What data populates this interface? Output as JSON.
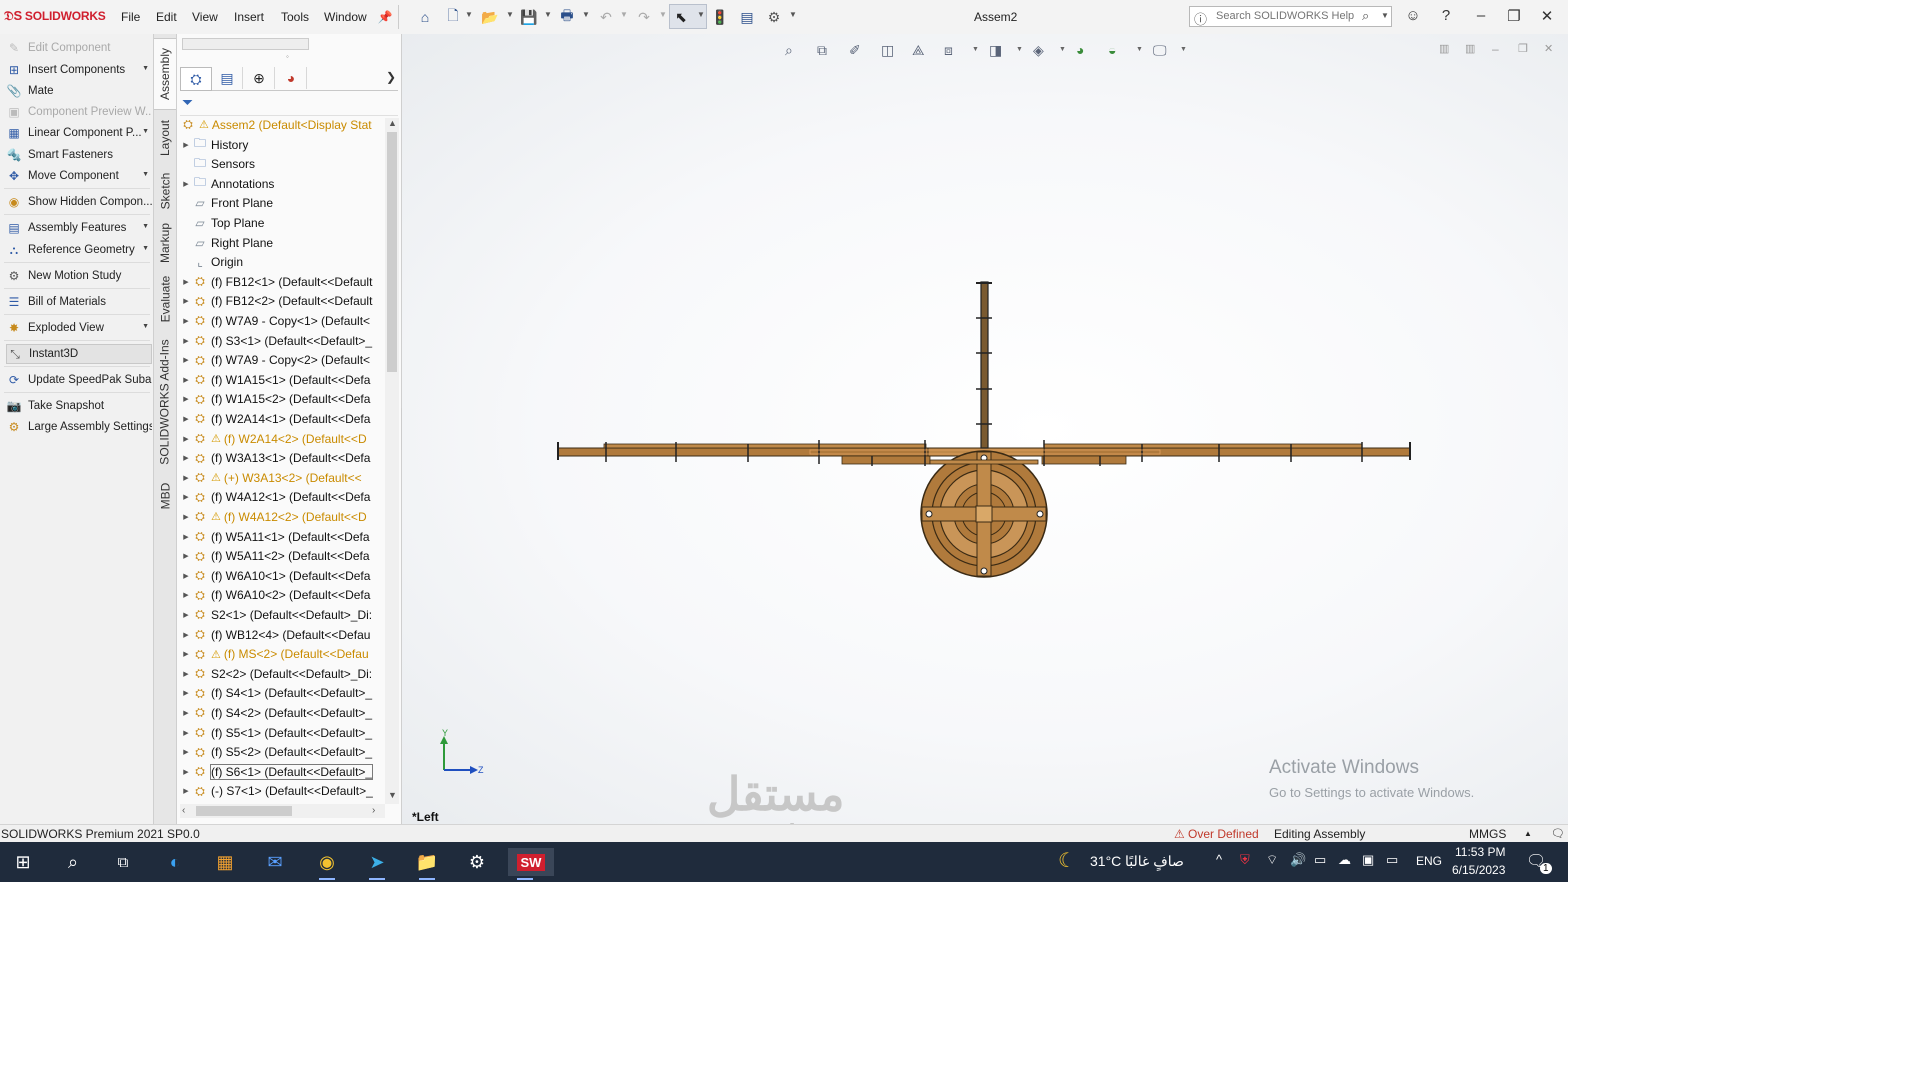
{
  "app": {
    "logo": "SOLIDWORKS",
    "document_title": "Assem2",
    "menus": [
      "File",
      "Edit",
      "View",
      "Insert",
      "Tools",
      "Window"
    ],
    "search_placeholder": "Search SOLIDWORKS Help"
  },
  "command_manager": {
    "items": [
      {
        "label": "Edit Component",
        "icon": "edit-component-icon",
        "enabled": false
      },
      {
        "label": "Insert Components",
        "icon": "insert-components-icon",
        "enabled": true,
        "dropdown": true
      },
      {
        "label": "Mate",
        "icon": "mate-icon",
        "enabled": true
      },
      {
        "label": "Component Preview W...",
        "icon": "component-preview-icon",
        "enabled": false
      },
      {
        "label": "Linear Component P...",
        "icon": "linear-pattern-icon",
        "enabled": true,
        "dropdown": true
      },
      {
        "label": "Smart Fasteners",
        "icon": "smart-fasteners-icon",
        "enabled": true
      },
      {
        "label": "Move Component",
        "icon": "move-component-icon",
        "enabled": true,
        "dropdown": true
      },
      {
        "label": "Show Hidden Compon...",
        "icon": "show-hidden-icon",
        "enabled": true
      },
      {
        "label": "Assembly Features",
        "icon": "assembly-features-icon",
        "enabled": true,
        "dropdown": true
      },
      {
        "label": "Reference Geometry",
        "icon": "reference-geometry-icon",
        "enabled": true,
        "dropdown": true
      },
      {
        "label": "New Motion Study",
        "icon": "motion-study-icon",
        "enabled": true
      },
      {
        "label": "Bill of Materials",
        "icon": "bom-icon",
        "enabled": true
      },
      {
        "label": "Exploded View",
        "icon": "exploded-view-icon",
        "enabled": true,
        "dropdown": true
      },
      {
        "label": "Instant3D",
        "icon": "instant3d-icon",
        "enabled": true,
        "active": true
      },
      {
        "label": "Update SpeedPak Suba...",
        "icon": "speedpak-icon",
        "enabled": true
      },
      {
        "label": "Take Snapshot",
        "icon": "snapshot-icon",
        "enabled": true
      },
      {
        "label": "Large Assembly Settings",
        "icon": "large-assembly-icon",
        "enabled": true
      }
    ]
  },
  "vertical_tabs": [
    "Assembly",
    "Layout",
    "Sketch",
    "Markup",
    "Evaluate",
    "SOLIDWORKS Add-Ins",
    "MBD"
  ],
  "feature_tree": {
    "root": "Assem2  (Default<Display Stat",
    "items": [
      {
        "label": "History",
        "type": "folder",
        "expand": true
      },
      {
        "label": "Sensors",
        "type": "folder",
        "expand": false
      },
      {
        "label": "Annotations",
        "type": "folder",
        "expand": true
      },
      {
        "label": "Front Plane",
        "type": "plane",
        "expand": false
      },
      {
        "label": "Top Plane",
        "type": "plane",
        "expand": false
      },
      {
        "label": "Right Plane",
        "type": "plane",
        "expand": false
      },
      {
        "label": "Origin",
        "type": "origin",
        "expand": false
      },
      {
        "label": "(f) FB12<1> (Default<<Default",
        "type": "part",
        "expand": true
      },
      {
        "label": "(f) FB12<2> (Default<<Default",
        "type": "part",
        "expand": true
      },
      {
        "label": "(f) W7A9 - Copy<1> (Default<",
        "type": "part",
        "expand": true
      },
      {
        "label": "(f) S3<1> (Default<<Default>_",
        "type": "part",
        "expand": true
      },
      {
        "label": "(f) W7A9 - Copy<2> (Default<",
        "type": "part",
        "expand": true
      },
      {
        "label": "(f) W1A15<1> (Default<<Defa",
        "type": "part",
        "expand": true
      },
      {
        "label": "(f) W1A15<2> (Default<<Defa",
        "type": "part",
        "expand": true
      },
      {
        "label": "(f) W2A14<1> (Default<<Defa",
        "type": "part",
        "expand": true
      },
      {
        "label": "(f) W2A14<2> (Default<<D",
        "type": "part",
        "expand": true,
        "warning": true
      },
      {
        "label": "(f) W3A13<1> (Default<<Defa",
        "type": "part",
        "expand": true
      },
      {
        "label": "(+) W3A13<2> (Default<<",
        "type": "part",
        "expand": true,
        "warning": true
      },
      {
        "label": "(f) W4A12<1> (Default<<Defa",
        "type": "part",
        "expand": true
      },
      {
        "label": "(f) W4A12<2> (Default<<D",
        "type": "part",
        "expand": true,
        "warning": true
      },
      {
        "label": "(f) W5A11<1> (Default<<Defa",
        "type": "part",
        "expand": true
      },
      {
        "label": "(f) W5A11<2> (Default<<Defa",
        "type": "part",
        "expand": true
      },
      {
        "label": "(f) W6A10<1> (Default<<Defa",
        "type": "part",
        "expand": true
      },
      {
        "label": "(f) W6A10<2> (Default<<Defa",
        "type": "part",
        "expand": true
      },
      {
        "label": "S2<1> (Default<<Default>_Di:",
        "type": "part",
        "expand": true
      },
      {
        "label": "(f) WB12<4> (Default<<Defau",
        "type": "part",
        "expand": true
      },
      {
        "label": "(f) MS<2> (Default<<Defau",
        "type": "part",
        "expand": true,
        "warning": true
      },
      {
        "label": "S2<2> (Default<<Default>_Di:",
        "type": "part",
        "expand": true
      },
      {
        "label": "(f) S4<1> (Default<<Default>_",
        "type": "part",
        "expand": true
      },
      {
        "label": "(f) S4<2> (Default<<Default>_",
        "type": "part",
        "expand": true
      },
      {
        "label": "(f) S5<1> (Default<<Default>_",
        "type": "part",
        "expand": true
      },
      {
        "label": "(f) S5<2> (Default<<Default>_",
        "type": "part",
        "expand": true
      },
      {
        "label": "(f) S6<1> (Default<<Default>_",
        "type": "part",
        "expand": true,
        "selected": true
      },
      {
        "label": "(-) S7<1> (Default<<Default>_",
        "type": "part",
        "expand": true
      }
    ]
  },
  "viewport": {
    "view_name": "*Left",
    "triad": {
      "y": "Y",
      "z": "Z"
    },
    "activate_title": "Activate Windows",
    "activate_sub": "Go to Settings to activate Windows.",
    "watermark_ar": "مستقل",
    "watermark_en": "mostaql.com"
  },
  "status_bar": {
    "product": "SOLIDWORKS Premium 2021 SP0.0",
    "constraint": "Over Defined",
    "mode": "Editing Assembly",
    "units": "MMGS"
  },
  "taskbar": {
    "weather_temp": "31°C",
    "weather_text": "صافٍ غالبًا",
    "language": "ENG",
    "time": "11:53 PM",
    "date": "6/15/2023",
    "notification_count": "1"
  },
  "colors": {
    "brand_red": "#d01f2e",
    "warning": "#c98b00",
    "model_wood": "#b07a3c",
    "taskbar_bg": "#1f2b3c"
  }
}
